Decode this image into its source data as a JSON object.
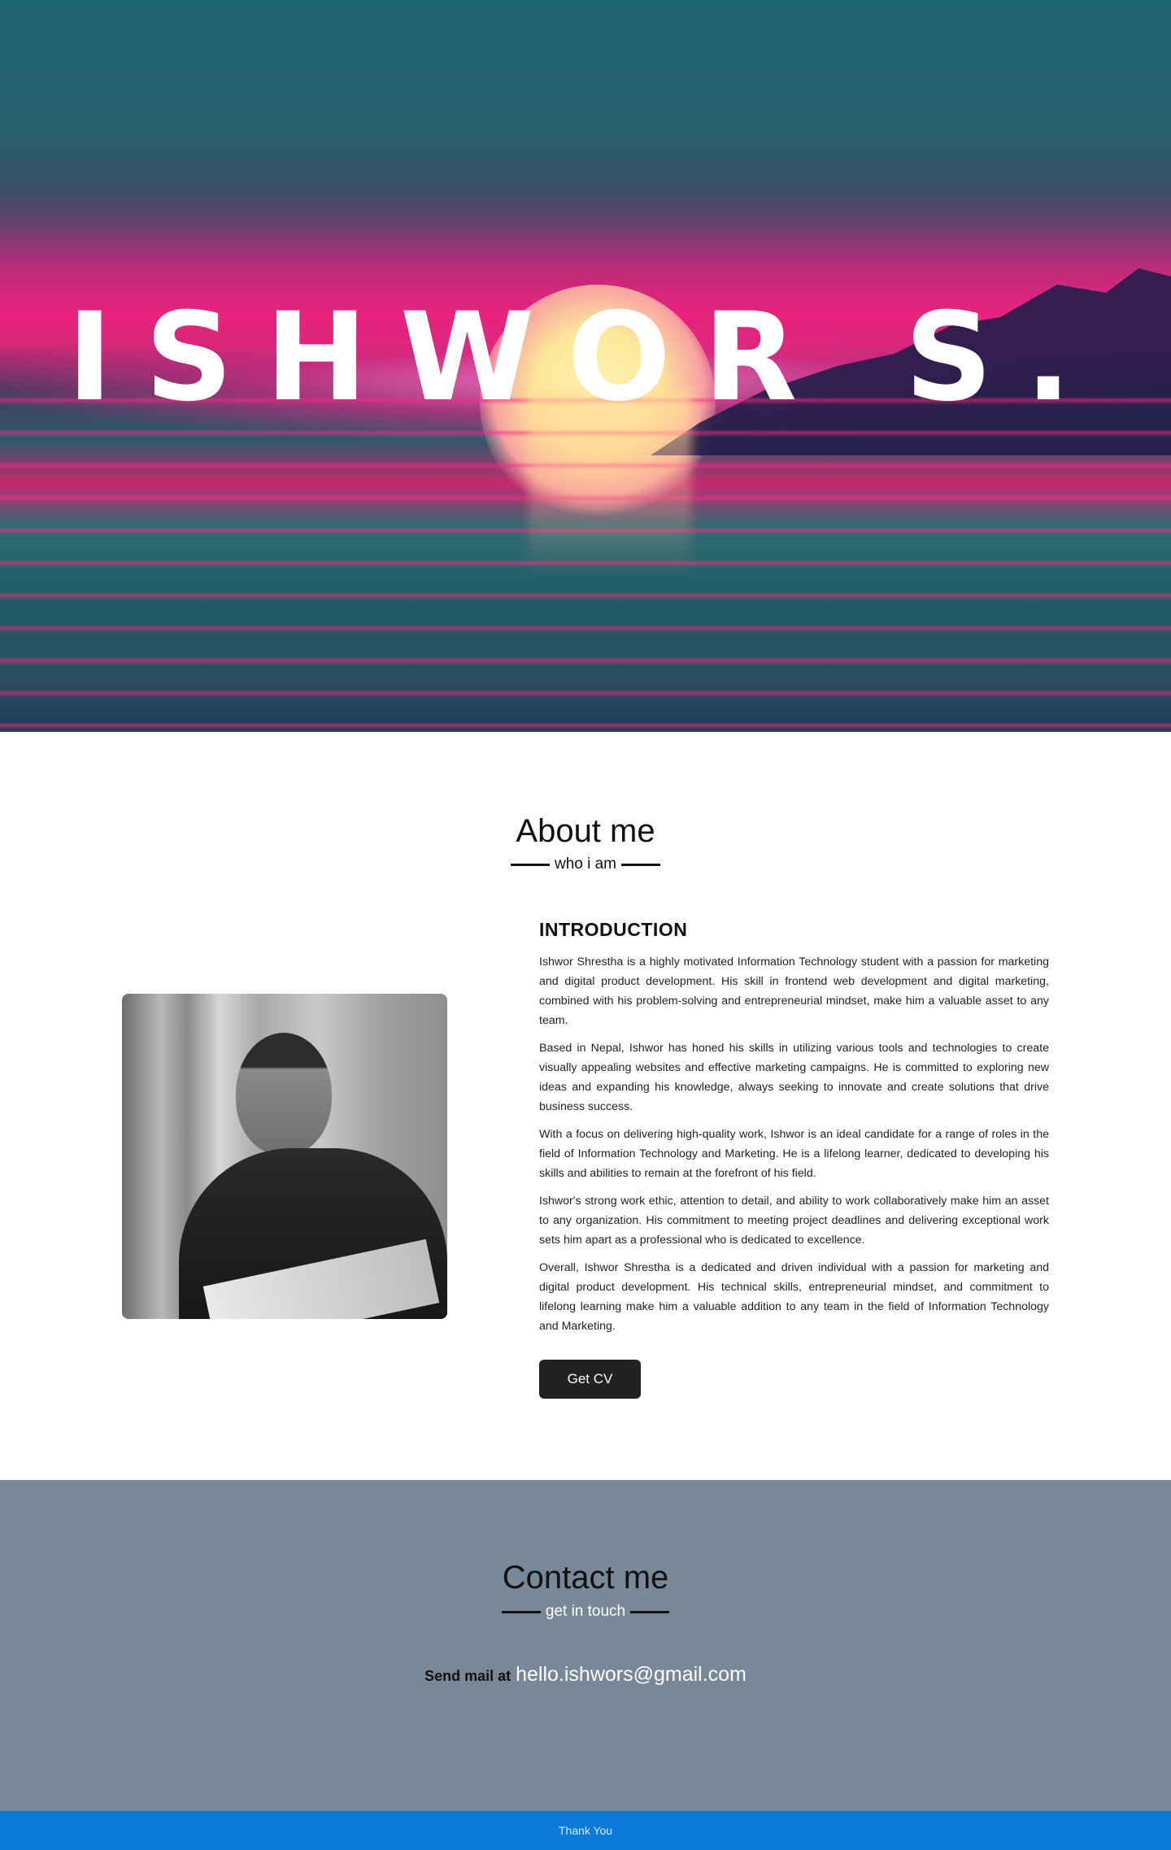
{
  "hero": {
    "title": "ISHWOR S."
  },
  "about": {
    "title": "About me",
    "subtitle": "who i am",
    "intro_heading": "INTRODUCTION",
    "paragraphs": [
      "Ishwor Shrestha is a highly motivated Information Technology student with a passion for marketing and digital product development. His skill in frontend web development and digital marketing, combined with his problem-solving and entrepreneurial mindset, make him a valuable asset to any team.",
      "Based in Nepal, Ishwor has honed his skills in utilizing various tools and technologies to create visually appealing websites and effective marketing campaigns. He is committed to exploring new ideas and expanding his knowledge, always seeking to innovate and create solutions that drive business success.",
      "With a focus on delivering high-quality work, Ishwor is an ideal candidate for a range of roles in the field of Information Technology and Marketing. He is a lifelong learner, dedicated to developing his skills and abilities to remain at the forefront of his field.",
      "Ishwor's strong work ethic, attention to detail, and ability to work collaboratively make him an asset to any organization. His commitment to meeting project deadlines and delivering exceptional work sets him apart as a professional who is dedicated to excellence.",
      "Overall, Ishwor Shrestha is a dedicated and driven individual with a passion for marketing and digital product development. His technical skills, entrepreneurial mindset, and commitment to lifelong learning make him a valuable addition to any team in the field of Information Technology and Marketing."
    ],
    "cv_button": "Get CV"
  },
  "contact": {
    "title": "Contact me",
    "subtitle": "get in touch",
    "mail_label": "Send mail at",
    "email": "hello.ishwors@gmail.com"
  },
  "footer": {
    "text": "Thank You"
  },
  "colors": {
    "contact_bg": "#798898",
    "footer_bg": "#0a7ad8",
    "button_bg": "#222222"
  }
}
